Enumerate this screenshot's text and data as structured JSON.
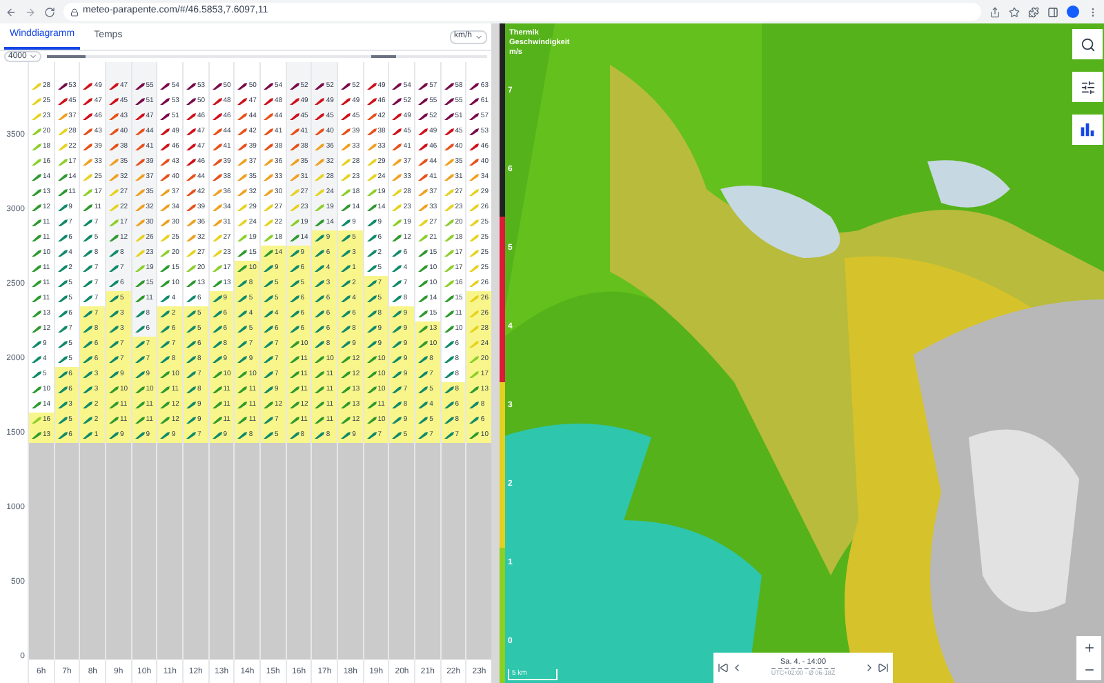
{
  "browser": {
    "url": "meteo-parapente.com/#/46.5853,7.6097,11"
  },
  "tabs": [
    {
      "label": "Winddiagramm",
      "selected": true
    },
    {
      "label": "Temps",
      "selected": false
    }
  ],
  "unit_select": "km/h",
  "altitude_select": "4000",
  "wind_chart": {
    "y_ticks": [
      "3500",
      "3000",
      "2500",
      "2000",
      "1500",
      "1000",
      "500",
      "0"
    ],
    "hours": [
      {
        "label": "6h",
        "shaded": false
      },
      {
        "label": "7h",
        "shaded": false
      },
      {
        "label": "8h",
        "shaded": false
      },
      {
        "label": "9h",
        "shaded": true
      },
      {
        "label": "10h",
        "shaded": true
      },
      {
        "label": "11h",
        "shaded": false
      },
      {
        "label": "12h",
        "shaded": false
      },
      {
        "label": "13h",
        "shaded": false
      },
      {
        "label": "14h",
        "shaded": false
      },
      {
        "label": "15h",
        "shaded": false
      },
      {
        "label": "16h",
        "shaded": true
      },
      {
        "label": "17h",
        "shaded": true
      },
      {
        "label": "18h",
        "shaded": false
      },
      {
        "label": "19h",
        "shaded": false
      },
      {
        "label": "20h",
        "shaded": false
      },
      {
        "label": "21h",
        "shaded": false
      },
      {
        "label": "22h",
        "shaded": false
      },
      {
        "label": "23h",
        "shaded": false
      }
    ],
    "rows": [
      {
        "speeds": [
          "28",
          "53",
          "49",
          "47",
          "55",
          "54",
          "53",
          "50",
          "50",
          "54",
          "52",
          "52",
          "52",
          "49",
          "54",
          "57",
          "58",
          "63"
        ],
        "thermal": [
          false,
          false,
          false,
          false,
          false,
          false,
          false,
          false,
          false,
          false,
          false,
          false,
          false,
          false,
          false,
          false,
          false,
          false
        ]
      },
      {
        "speeds": [
          "25",
          "45",
          "47",
          "45",
          "51",
          "53",
          "50",
          "48",
          "47",
          "48",
          "49",
          "49",
          "49",
          "46",
          "52",
          "55",
          "55",
          "61"
        ],
        "thermal": [
          false,
          false,
          false,
          false,
          false,
          false,
          false,
          false,
          false,
          false,
          false,
          false,
          false,
          false,
          false,
          false,
          false,
          false
        ]
      },
      {
        "speeds": [
          "23",
          "37",
          "46",
          "43",
          "47",
          "51",
          "46",
          "46",
          "44",
          "44",
          "45",
          "45",
          "45",
          "42",
          "49",
          "52",
          "51",
          "57"
        ],
        "thermal": [
          false,
          false,
          false,
          false,
          false,
          false,
          false,
          false,
          false,
          false,
          false,
          false,
          false,
          false,
          false,
          false,
          false,
          false
        ]
      },
      {
        "speeds": [
          "20",
          "28",
          "43",
          "40",
          "44",
          "49",
          "47",
          "44",
          "42",
          "41",
          "41",
          "40",
          "39",
          "38",
          "45",
          "49",
          "45",
          "53"
        ],
        "thermal": [
          false,
          false,
          false,
          false,
          false,
          false,
          false,
          false,
          false,
          false,
          false,
          false,
          false,
          false,
          false,
          false,
          false,
          false
        ]
      },
      {
        "speeds": [
          "18",
          "22",
          "39",
          "38",
          "41",
          "46",
          "47",
          "41",
          "39",
          "38",
          "38",
          "36",
          "33",
          "33",
          "41",
          "46",
          "40",
          "46"
        ],
        "thermal": [
          false,
          false,
          false,
          false,
          false,
          false,
          false,
          false,
          false,
          false,
          false,
          false,
          false,
          false,
          false,
          false,
          false,
          false
        ]
      },
      {
        "speeds": [
          "16",
          "17",
          "33",
          "35",
          "39",
          "43",
          "46",
          "39",
          "37",
          "36",
          "35",
          "32",
          "28",
          "29",
          "37",
          "44",
          "35",
          "40"
        ],
        "thermal": [
          false,
          false,
          false,
          false,
          false,
          false,
          false,
          false,
          false,
          false,
          false,
          false,
          false,
          false,
          false,
          false,
          false,
          false
        ]
      },
      {
        "speeds": [
          "14",
          "14",
          "25",
          "32",
          "37",
          "40",
          "44",
          "38",
          "35",
          "33",
          "31",
          "28",
          "23",
          "24",
          "33",
          "41",
          "31",
          "34"
        ],
        "thermal": [
          false,
          false,
          false,
          false,
          false,
          false,
          false,
          false,
          false,
          false,
          false,
          false,
          false,
          false,
          false,
          false,
          false,
          false
        ]
      },
      {
        "speeds": [
          "13",
          "11",
          "17",
          "27",
          "35",
          "37",
          "42",
          "36",
          "32",
          "30",
          "27",
          "24",
          "18",
          "19",
          "28",
          "37",
          "27",
          "29"
        ],
        "thermal": [
          false,
          false,
          false,
          false,
          false,
          false,
          false,
          false,
          false,
          false,
          false,
          false,
          false,
          false,
          false,
          false,
          false,
          false
        ]
      },
      {
        "speeds": [
          "12",
          "9",
          "11",
          "22",
          "32",
          "34",
          "39",
          "34",
          "29",
          "27",
          "23",
          "19",
          "14",
          "14",
          "23",
          "33",
          "23",
          "26"
        ],
        "thermal": [
          false,
          false,
          false,
          false,
          false,
          false,
          false,
          false,
          false,
          false,
          false,
          false,
          false,
          false,
          false,
          false,
          false,
          false
        ]
      },
      {
        "speeds": [
          "11",
          "7",
          "7",
          "17",
          "30",
          "30",
          "36",
          "31",
          "24",
          "22",
          "19",
          "14",
          "9",
          "9",
          "19",
          "27",
          "20",
          "25"
        ],
        "thermal": [
          false,
          false,
          false,
          false,
          false,
          false,
          false,
          false,
          false,
          false,
          false,
          false,
          false,
          false,
          false,
          false,
          false,
          false
        ]
      },
      {
        "speeds": [
          "11",
          "6",
          "5",
          "12",
          "26",
          "25",
          "32",
          "27",
          "19",
          "18",
          "14",
          "9",
          "5",
          "6",
          "12",
          "21",
          "18",
          "25"
        ],
        "thermal": [
          false,
          false,
          false,
          false,
          false,
          false,
          false,
          false,
          false,
          false,
          false,
          true,
          true,
          false,
          false,
          false,
          false,
          false
        ]
      },
      {
        "speeds": [
          "10",
          "4",
          "8",
          "8",
          "23",
          "20",
          "27",
          "23",
          "15",
          "14",
          "9",
          "6",
          "3",
          "2",
          "6",
          "15",
          "17",
          "25"
        ],
        "thermal": [
          false,
          false,
          false,
          false,
          false,
          false,
          false,
          false,
          false,
          true,
          true,
          true,
          true,
          false,
          false,
          false,
          false,
          false
        ]
      },
      {
        "speeds": [
          "11",
          "2",
          "7",
          "7",
          "19",
          "15",
          "20",
          "17",
          "10",
          "9",
          "6",
          "4",
          "1",
          "5",
          "4",
          "10",
          "17",
          "25"
        ],
        "thermal": [
          false,
          false,
          false,
          false,
          false,
          false,
          false,
          false,
          true,
          true,
          true,
          true,
          true,
          false,
          false,
          false,
          false,
          false
        ]
      },
      {
        "speeds": [
          "11",
          "5",
          "7",
          "6",
          "15",
          "10",
          "13",
          "13",
          "8",
          "5",
          "5",
          "3",
          "2",
          "7",
          "7",
          "10",
          "16",
          "26"
        ],
        "thermal": [
          false,
          false,
          false,
          false,
          false,
          false,
          false,
          false,
          true,
          true,
          true,
          true,
          true,
          true,
          false,
          false,
          false,
          false
        ]
      },
      {
        "speeds": [
          "11",
          "5",
          "7",
          "5",
          "11",
          "4",
          "6",
          "9",
          "5",
          "5",
          "6",
          "6",
          "4",
          "5",
          "8",
          "14",
          "15",
          "26"
        ],
        "thermal": [
          false,
          false,
          false,
          true,
          false,
          false,
          false,
          true,
          true,
          true,
          true,
          true,
          true,
          true,
          false,
          false,
          false,
          true
        ]
      },
      {
        "speeds": [
          "13",
          "6",
          "7",
          "3",
          "8",
          "2",
          "5",
          "6",
          "4",
          "4",
          "6",
          "6",
          "6",
          "8",
          "9",
          "15",
          "11",
          "26"
        ],
        "thermal": [
          false,
          false,
          true,
          true,
          false,
          true,
          true,
          true,
          true,
          true,
          true,
          true,
          true,
          true,
          true,
          false,
          false,
          true
        ]
      },
      {
        "speeds": [
          "12",
          "7",
          "8",
          "3",
          "6",
          "6",
          "5",
          "6",
          "5",
          "6",
          "6",
          "6",
          "8",
          "9",
          "9",
          "13",
          "10",
          "28"
        ],
        "thermal": [
          false,
          false,
          true,
          true,
          false,
          true,
          true,
          true,
          true,
          true,
          true,
          true,
          true,
          true,
          true,
          true,
          false,
          true
        ]
      },
      {
        "speeds": [
          "9",
          "5",
          "6",
          "7",
          "7",
          "7",
          "6",
          "8",
          "7",
          "7",
          "10",
          "8",
          "9",
          "9",
          "9",
          "10",
          "6",
          "24"
        ],
        "thermal": [
          false,
          false,
          true,
          true,
          true,
          true,
          true,
          true,
          true,
          true,
          true,
          true,
          true,
          true,
          true,
          true,
          false,
          true
        ]
      },
      {
        "speeds": [
          "4",
          "5",
          "6",
          "7",
          "7",
          "8",
          "8",
          "9",
          "9",
          "7",
          "11",
          "10",
          "12",
          "10",
          "9",
          "8",
          "8",
          "20"
        ],
        "thermal": [
          false,
          false,
          true,
          true,
          true,
          true,
          true,
          true,
          true,
          true,
          true,
          true,
          true,
          true,
          true,
          true,
          false,
          true
        ]
      },
      {
        "speeds": [
          "5",
          "6",
          "3",
          "9",
          "9",
          "10",
          "7",
          "10",
          "10",
          "7",
          "11",
          "11",
          "12",
          "10",
          "9",
          "7",
          "8",
          "17"
        ],
        "thermal": [
          false,
          true,
          true,
          true,
          true,
          true,
          true,
          true,
          true,
          true,
          true,
          true,
          true,
          true,
          true,
          true,
          false,
          true
        ]
      },
      {
        "speeds": [
          "10",
          "6",
          "3",
          "10",
          "10",
          "11",
          "8",
          "11",
          "11",
          "9",
          "11",
          "11",
          "13",
          "10",
          "7",
          "5",
          "8",
          "13"
        ],
        "thermal": [
          false,
          true,
          true,
          true,
          true,
          true,
          true,
          true,
          true,
          true,
          true,
          true,
          true,
          true,
          true,
          true,
          true,
          true
        ]
      },
      {
        "speeds": [
          "14",
          "3",
          "2",
          "11",
          "11",
          "12",
          "9",
          "11",
          "11",
          "12",
          "12",
          "11",
          "13",
          "11",
          "8",
          "4",
          "6",
          "8"
        ],
        "thermal": [
          false,
          true,
          true,
          true,
          true,
          true,
          true,
          true,
          true,
          true,
          true,
          true,
          true,
          true,
          true,
          true,
          true,
          true
        ]
      },
      {
        "speeds": [
          "16",
          "5",
          "2",
          "11",
          "11",
          "12",
          "9",
          "11",
          "11",
          "7",
          "11",
          "11",
          "12",
          "10",
          "9",
          "5",
          "8",
          "6"
        ],
        "thermal": [
          true,
          true,
          true,
          true,
          true,
          true,
          true,
          true,
          true,
          true,
          true,
          true,
          true,
          true,
          true,
          true,
          true,
          true
        ]
      },
      {
        "speeds": [
          "13",
          "6",
          "1",
          "9",
          "9",
          "9",
          "7",
          "9",
          "8",
          "5",
          "8",
          "8",
          "9",
          "7",
          "5",
          "7",
          "7",
          "10"
        ],
        "thermal": [
          true,
          true,
          true,
          true,
          true,
          true,
          true,
          true,
          true,
          true,
          true,
          true,
          true,
          true,
          true,
          true,
          true,
          true
        ]
      }
    ]
  },
  "map": {
    "legend_title": [
      "Thermik",
      "Geschwindigkeit",
      "m/s"
    ],
    "legend_labels": [
      "7",
      "6",
      "5",
      "4",
      "3",
      "2",
      "1",
      "0"
    ],
    "scale": "5 km",
    "time_control": {
      "date": "Sa. 4. - 14:00",
      "zone": "UTC+02:00 - Ø 06-18Z"
    }
  }
}
